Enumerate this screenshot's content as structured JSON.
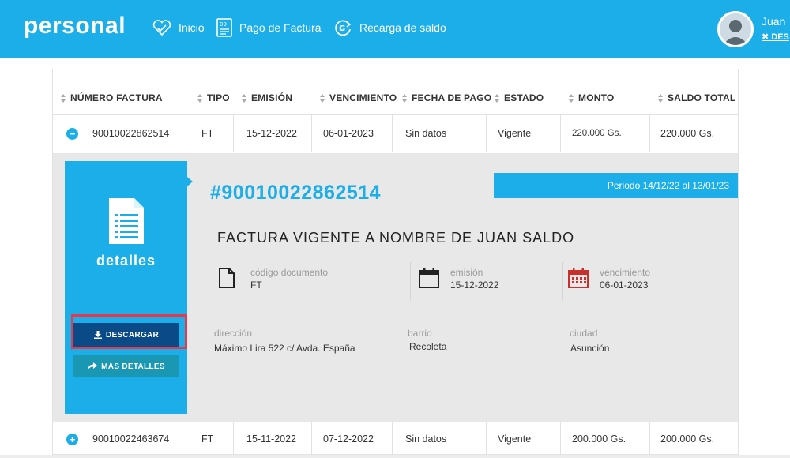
{
  "header": {
    "logo": "personal",
    "nav": [
      {
        "label": "Inicio",
        "icon": "heart-icon"
      },
      {
        "label": "Pago de Factura",
        "icon": "invoice-icon"
      },
      {
        "label": "Recarga de saldo",
        "icon": "recharge-icon"
      }
    ],
    "user": {
      "name": "Juan",
      "logout": "✖ DES"
    }
  },
  "table": {
    "columns": [
      "NÚMERO FACTURA",
      "TIPO",
      "EMISIÓN",
      "VENCIMIENTO",
      "FECHA DE PAGO",
      "ESTADO",
      "MONTO",
      "SALDO TOTAL"
    ],
    "rows": [
      {
        "toggle": "−",
        "numero": "90010022862514",
        "tipo": "FT",
        "emision": "15-12-2022",
        "vencimiento": "06-01-2023",
        "fecha_pago": "Sin datos",
        "estado": "Vigente",
        "monto": "220.000 Gs.",
        "saldo": "220.000 Gs."
      },
      {
        "toggle": "+",
        "numero": "90010022463674",
        "tipo": "FT",
        "emision": "15-11-2022",
        "vencimiento": "07-12-2022",
        "fecha_pago": "Sin datos",
        "estado": "Vigente",
        "monto": "200.000 Gs.",
        "saldo": "200.000 Gs."
      }
    ]
  },
  "detail": {
    "panel_title": "detalles",
    "download_label": "DESCARGAR",
    "more_label": "MÁS DETALLES",
    "invoice_number": "#90010022862514",
    "periodo": "Periodo 14/12/22 al 13/01/23",
    "title": "FACTURA VIGENTE A NOMBRE DE JUAN SALDO",
    "codigo": {
      "label": "código documento",
      "value": "FT"
    },
    "emision": {
      "label": "emisión",
      "value": "15-12-2022"
    },
    "vencimiento": {
      "label": "vencimiento",
      "value": "06-01-2023"
    },
    "direccion": {
      "label": "dirección",
      "value": "Máximo Lira 522 c/ Avda. España"
    },
    "barrio": {
      "label": "barrio",
      "value": "Recoleta"
    },
    "ciudad": {
      "label": "ciudad",
      "value": "Asunción"
    }
  },
  "colors": {
    "brand": "#1baee8",
    "download": "#0a4a86",
    "more": "#1997b3",
    "highlight": "#e53a4e",
    "calendar_red": "#c9302c"
  }
}
